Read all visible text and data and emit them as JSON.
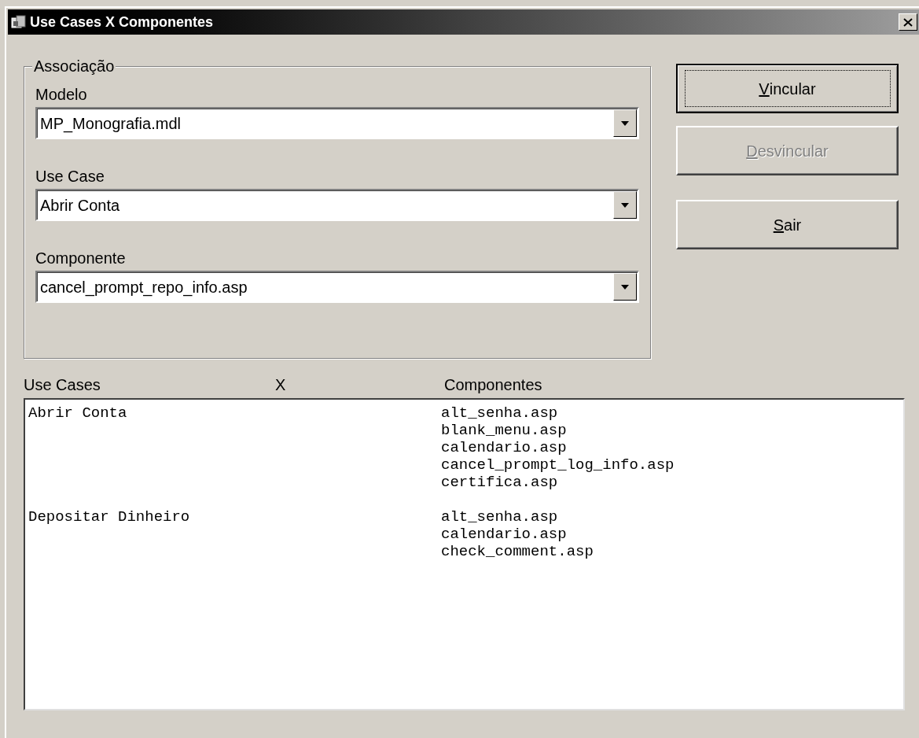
{
  "window": {
    "title": "Use Cases X Componentes"
  },
  "association": {
    "title": "Associação",
    "fields": [
      {
        "label": "Modelo",
        "value": "MP_Monografia.mdl"
      },
      {
        "label": "Use Case",
        "value": "Abrir Conta"
      },
      {
        "label": "Componente",
        "value": "cancel_prompt_repo_info.asp"
      }
    ]
  },
  "buttons": [
    {
      "label": "Vincular",
      "default": true,
      "disabled": false
    },
    {
      "label": "Desvincular",
      "default": false,
      "disabled": true
    },
    {
      "label": "Sair",
      "default": false,
      "disabled": false
    }
  ],
  "list": {
    "columns": [
      "Use Cases",
      "X",
      "Componentes"
    ],
    "groups": [
      {
        "use_case": "Abrir Conta",
        "components": [
          "alt_senha.asp",
          "blank_menu.asp",
          "calendario.asp",
          "cancel_prompt_log_info.asp",
          "certifica.asp"
        ]
      },
      {
        "use_case": "Depositar Dinheiro",
        "components": [
          "alt_senha.asp",
          "calendario.asp",
          "check_comment.asp"
        ]
      }
    ]
  }
}
